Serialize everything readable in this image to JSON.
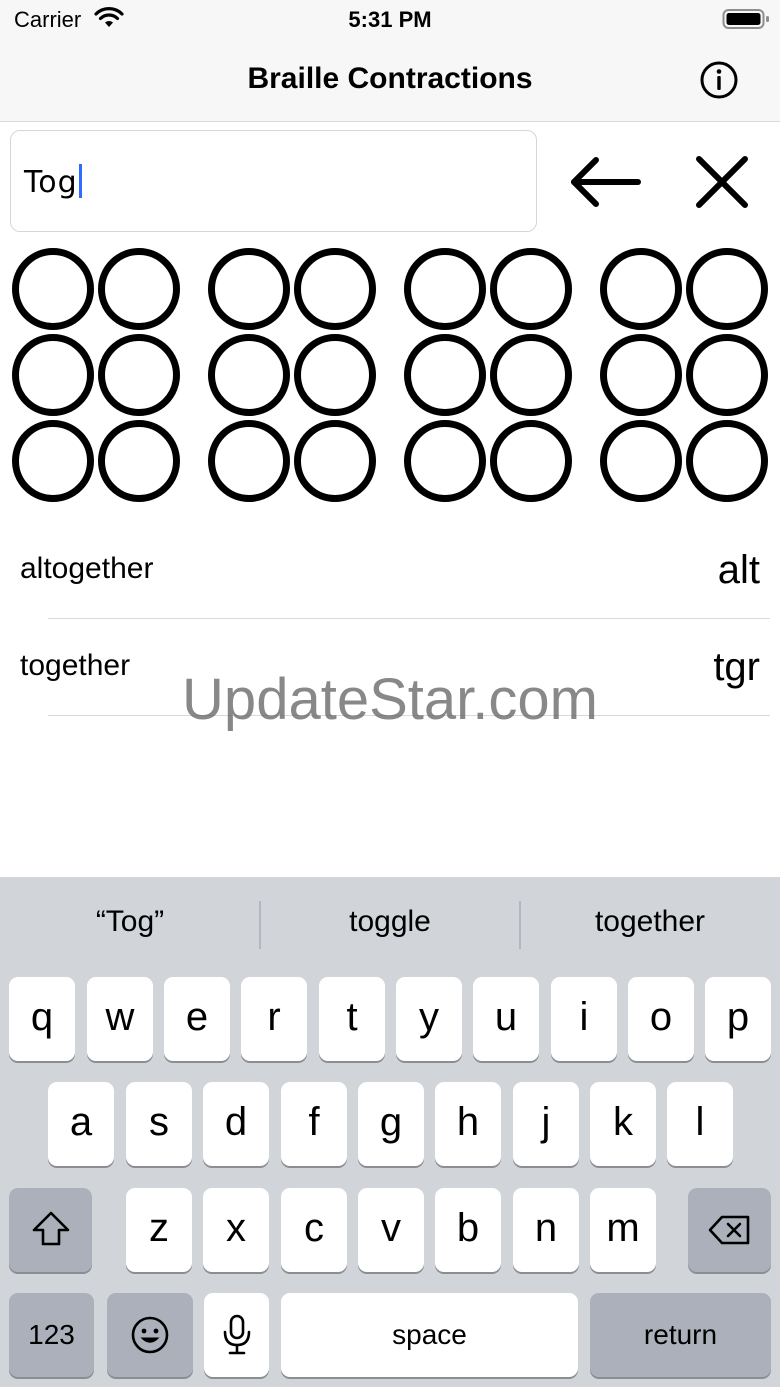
{
  "status_bar": {
    "carrier": "Carrier",
    "time": "5:31 PM"
  },
  "nav": {
    "title": "Braille Contractions",
    "info_icon": "info-circle-icon"
  },
  "search": {
    "value": "Tog",
    "backspace_icon": "left-arrow-icon",
    "clear_icon": "close-icon"
  },
  "braille": {
    "cells": 4,
    "dots_per_cell": 6,
    "filled_dots": []
  },
  "results": [
    {
      "word": "altogether",
      "contraction": "alt"
    },
    {
      "word": "together",
      "contraction": "tgr"
    }
  ],
  "watermark": "UpdateStar.com",
  "keyboard": {
    "suggestions": [
      "“Tog”",
      "toggle",
      "together"
    ],
    "row1": [
      "q",
      "w",
      "e",
      "r",
      "t",
      "y",
      "u",
      "i",
      "o",
      "p"
    ],
    "row2": [
      "a",
      "s",
      "d",
      "f",
      "g",
      "h",
      "j",
      "k",
      "l"
    ],
    "row3": [
      "z",
      "x",
      "c",
      "v",
      "b",
      "n",
      "m"
    ],
    "numbers_label": "123",
    "space_label": "space",
    "return_label": "return",
    "shift_icon": "shift-icon",
    "delete_icon": "delete-icon",
    "emoji_icon": "emoji-icon",
    "mic_icon": "microphone-icon"
  }
}
